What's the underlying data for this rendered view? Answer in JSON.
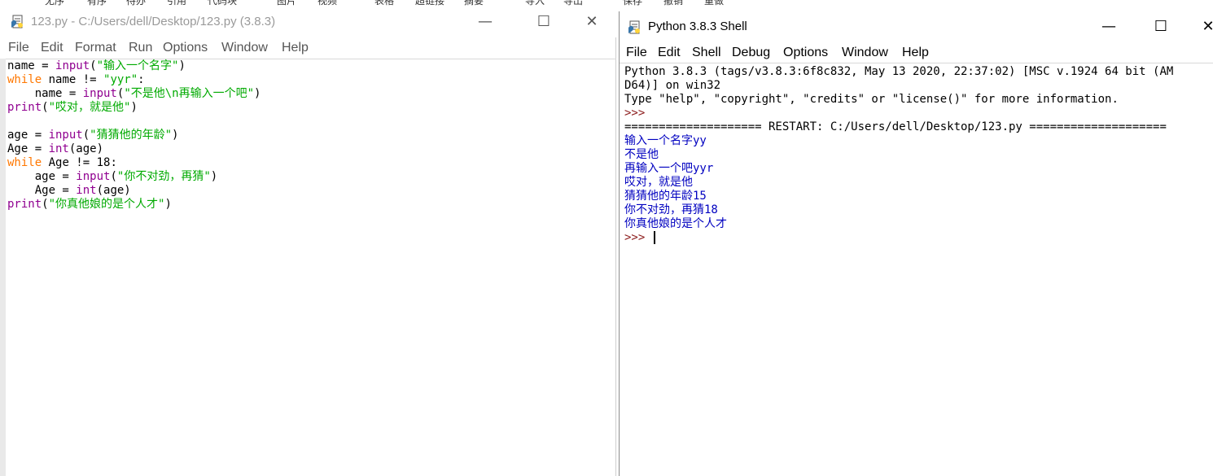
{
  "background_strip": [
    "无序",
    "有序",
    "待办",
    "引用",
    "代码块",
    "图片",
    "视频",
    "表格",
    "超链接",
    "摘要",
    "导入",
    "导出",
    "保存",
    "撤销",
    "重做"
  ],
  "editor": {
    "title": "123.py - C:/Users/dell/Desktop/123.py (3.8.3)",
    "window_buttons": {
      "minimize": "—",
      "maximize": "☐",
      "close": "✕"
    },
    "menu": [
      "File",
      "Edit",
      "Format",
      "Run",
      "Options",
      "Window",
      "Help"
    ],
    "code_lines": [
      [
        {
          "t": "name = ",
          "c": ""
        },
        {
          "t": "input",
          "c": "bi"
        },
        {
          "t": "(",
          "c": ""
        },
        {
          "t": "\"输入一个名字\"",
          "c": "str"
        },
        {
          "t": ")",
          "c": ""
        }
      ],
      [
        {
          "t": "while",
          "c": "kw"
        },
        {
          "t": " name != ",
          "c": ""
        },
        {
          "t": "\"yyr\"",
          "c": "str"
        },
        {
          "t": ":",
          "c": ""
        }
      ],
      [
        {
          "t": "    name = ",
          "c": ""
        },
        {
          "t": "input",
          "c": "bi"
        },
        {
          "t": "(",
          "c": ""
        },
        {
          "t": "\"不是他\\n再输入一个吧\"",
          "c": "str"
        },
        {
          "t": ")",
          "c": ""
        }
      ],
      [
        {
          "t": "print",
          "c": "bi"
        },
        {
          "t": "(",
          "c": ""
        },
        {
          "t": "\"哎对，就是他\"",
          "c": "str"
        },
        {
          "t": ")",
          "c": ""
        }
      ],
      [],
      [
        {
          "t": "age = ",
          "c": ""
        },
        {
          "t": "input",
          "c": "bi"
        },
        {
          "t": "(",
          "c": ""
        },
        {
          "t": "\"猜猜他的年龄\"",
          "c": "str"
        },
        {
          "t": ")",
          "c": ""
        }
      ],
      [
        {
          "t": "Age = ",
          "c": ""
        },
        {
          "t": "int",
          "c": "bi"
        },
        {
          "t": "(age)",
          "c": ""
        }
      ],
      [
        {
          "t": "while",
          "c": "kw"
        },
        {
          "t": " Age != 18:",
          "c": ""
        }
      ],
      [
        {
          "t": "    age = ",
          "c": ""
        },
        {
          "t": "input",
          "c": "bi"
        },
        {
          "t": "(",
          "c": ""
        },
        {
          "t": "\"你不对劲，再猜\"",
          "c": "str"
        },
        {
          "t": ")",
          "c": ""
        }
      ],
      [
        {
          "t": "    Age = ",
          "c": ""
        },
        {
          "t": "int",
          "c": "bi"
        },
        {
          "t": "(age)",
          "c": ""
        }
      ],
      [
        {
          "t": "print",
          "c": "bi"
        },
        {
          "t": "(",
          "c": ""
        },
        {
          "t": "\"你真他娘的是个人才\"",
          "c": "str"
        },
        {
          "t": ")",
          "c": ""
        }
      ]
    ]
  },
  "shell": {
    "title": "Python 3.8.3 Shell",
    "window_buttons": {
      "minimize": "—",
      "maximize": "☐",
      "close": "✕"
    },
    "menu": [
      "File",
      "Edit",
      "Shell",
      "Debug",
      "Options",
      "Window",
      "Help"
    ],
    "output_lines": [
      {
        "t": "Python 3.8.3 (tags/v3.8.3:6f8c832, May 13 2020, 22:37:02) [MSC v.1924 64 bit (AM",
        "c": ""
      },
      {
        "t": "D64)] on win32",
        "c": ""
      },
      {
        "t": "Type \"help\", \"copyright\", \"credits\" or \"license()\" for more information.",
        "c": ""
      },
      {
        "t": ">>> ",
        "c": "prompt"
      },
      {
        "t": "==================== RESTART: C:/Users/dell/Desktop/123.py ====================",
        "c": ""
      },
      {
        "t": "输入一个名字yy",
        "c": "out-blue"
      },
      {
        "t": "不是他",
        "c": "out-blue"
      },
      {
        "t": "再输入一个吧yyr",
        "c": "out-blue"
      },
      {
        "t": "哎对，就是他",
        "c": "out-blue"
      },
      {
        "t": "猜猜他的年龄15",
        "c": "out-blue"
      },
      {
        "t": "你不对劲，再猜18",
        "c": "out-blue"
      },
      {
        "t": "你真他娘的是个人才",
        "c": "out-blue"
      },
      {
        "t": ">>> ",
        "c": "prompt",
        "cursor": true
      }
    ]
  }
}
